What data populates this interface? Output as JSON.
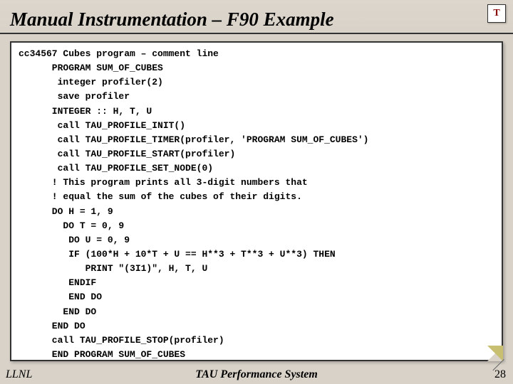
{
  "header": {
    "title": "Manual Instrumentation – F90 Example",
    "logo_letter": "T"
  },
  "code": "cc34567 Cubes program – comment line\n      PROGRAM SUM_OF_CUBES\n       integer profiler(2)\n       save profiler\n      INTEGER :: H, T, U\n       call TAU_PROFILE_INIT()\n       call TAU_PROFILE_TIMER(profiler, 'PROGRAM SUM_OF_CUBES')\n       call TAU_PROFILE_START(profiler)\n       call TAU_PROFILE_SET_NODE(0)\n      ! This program prints all 3-digit numbers that\n      ! equal the sum of the cubes of their digits.\n      DO H = 1, 9\n        DO T = 0, 9\n         DO U = 0, 9\n         IF (100*H + 10*T + U == H**3 + T**3 + U**3) THEN\n            PRINT \"(3I1)\", H, T, U\n         ENDIF\n         END DO\n        END DO\n      END DO\n      call TAU_PROFILE_STOP(profiler)\n      END PROGRAM SUM_OF_CUBES",
  "footer": {
    "left": "LLNL",
    "center": "TAU Performance System",
    "right": "28"
  }
}
